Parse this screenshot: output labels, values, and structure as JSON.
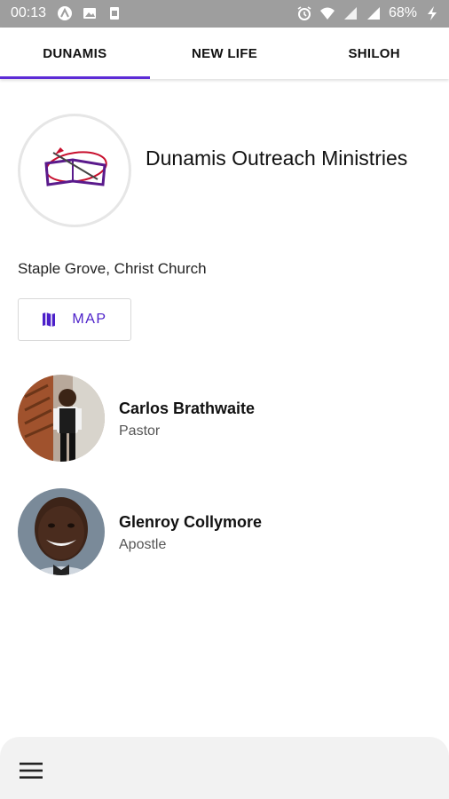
{
  "status_bar": {
    "time": "00:13",
    "battery": "68%"
  },
  "tabs": [
    {
      "label": "DUNAMIS",
      "active": true
    },
    {
      "label": "NEW LIFE",
      "active": false
    },
    {
      "label": "SHILOH",
      "active": false
    }
  ],
  "church": {
    "name": "Dunamis Outreach Ministries",
    "location": "Staple Grove, Christ Church"
  },
  "map_button": {
    "label": "MAP",
    "icon": "map-icon"
  },
  "people": [
    {
      "name": "Carlos Brathwaite",
      "role": "Pastor"
    },
    {
      "name": "Glenroy Collymore",
      "role": "Apostle"
    }
  ],
  "colors": {
    "accent": "#5c2bd6",
    "status_bar": "#9e9e9e",
    "bottom_bar": "#f2f2f2"
  }
}
